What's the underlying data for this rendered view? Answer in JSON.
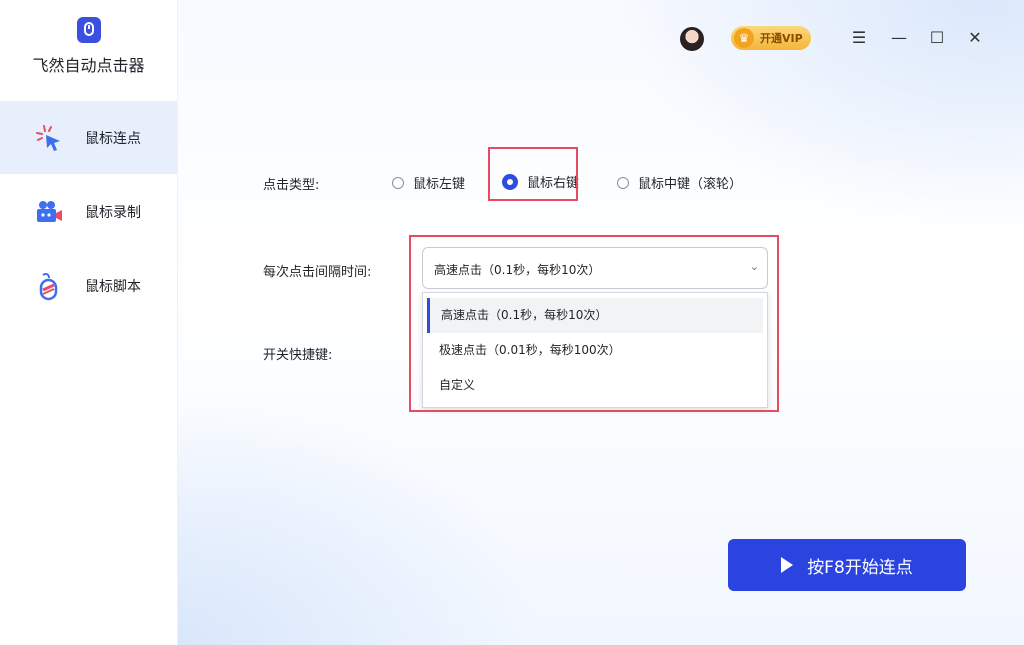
{
  "app": {
    "title": "飞然自动点击器"
  },
  "sidebar": {
    "items": [
      {
        "label": "鼠标连点",
        "icon": "cursor-click-icon",
        "active": true
      },
      {
        "label": "鼠标录制",
        "icon": "video-camera-icon",
        "active": false
      },
      {
        "label": "鼠标脚本",
        "icon": "mouse-script-icon",
        "active": false
      }
    ]
  },
  "header": {
    "vip_label": "开通VIP",
    "window_controls": {
      "menu": "☰",
      "minimize": "—",
      "maximize": "☐",
      "close": "✕"
    }
  },
  "form": {
    "click_type_label": "点击类型:",
    "click_types": [
      {
        "label": "鼠标左键",
        "checked": false
      },
      {
        "label": "鼠标右键",
        "checked": true
      },
      {
        "label": "鼠标中键（滚轮）",
        "checked": false
      }
    ],
    "interval_label": "每次点击间隔时间:",
    "interval_selected": "高速点击（0.1秒，每秒10次）",
    "interval_options": [
      "高速点击（0.1秒，每秒10次）",
      "极速点击（0.01秒，每秒100次）",
      "自定义"
    ],
    "hotkey_label": "开关快捷键:"
  },
  "start_button": {
    "label": "按F8开始连点"
  },
  "colors": {
    "accent": "#2b44e0",
    "highlight": "#e64b61",
    "active_nav": "#e7eefc"
  }
}
